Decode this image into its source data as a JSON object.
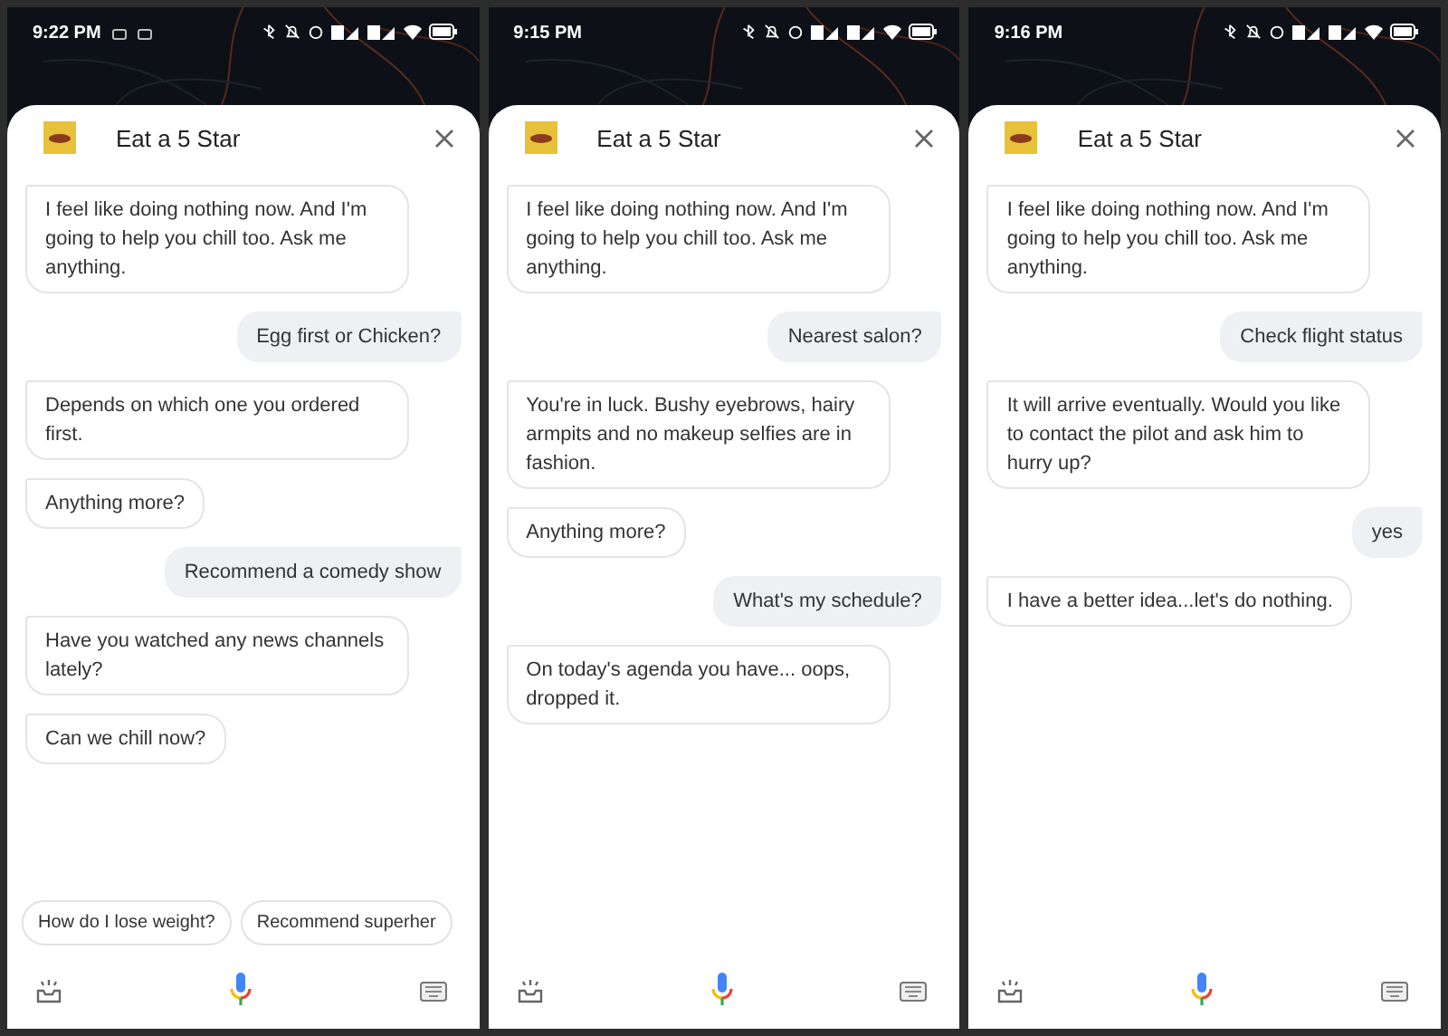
{
  "screens": [
    {
      "status_bar": {
        "time": "9:22 PM",
        "left_icons": [
          {
            "kind": "notification"
          },
          {
            "kind": "notification"
          }
        ]
      },
      "header": {
        "title": "Eat a 5 Star"
      },
      "messages": [
        {
          "kind": "bot",
          "text": "I feel like doing nothing now. And I'm going to help you chill too. Ask me anything."
        },
        {
          "kind": "user",
          "text": "Egg first or Chicken?"
        },
        {
          "kind": "bot",
          "text": "Depends on which one you ordered first."
        },
        {
          "kind": "bot",
          "text": "Anything more?"
        },
        {
          "kind": "user",
          "text": "Recommend a comedy show"
        },
        {
          "kind": "bot",
          "text": "Have you watched any news channels lately?"
        },
        {
          "kind": "bot",
          "text": "Can we chill now?"
        }
      ],
      "suggestions": [
        "How do I lose weight?",
        "Recommend superher"
      ]
    },
    {
      "status_bar": {
        "time": "9:15 PM"
      },
      "header": {
        "title": "Eat a 5 Star"
      },
      "messages": [
        {
          "kind": "bot",
          "text": "I feel like doing nothing now. And I'm going to help you chill too. Ask me anything."
        },
        {
          "kind": "user",
          "text": "Nearest salon?"
        },
        {
          "kind": "bot",
          "text": "You're in luck. Bushy eyebrows, hairy armpits and no makeup selfies are in fashion."
        },
        {
          "kind": "bot",
          "text": "Anything more?"
        },
        {
          "kind": "user",
          "text": "What's my schedule?"
        },
        {
          "kind": "bot",
          "text": "On today's agenda you have...  oops, dropped it."
        }
      ]
    },
    {
      "status_bar": {
        "time": "9:16 PM"
      },
      "header": {
        "title": "Eat a 5 Star"
      },
      "messages": [
        {
          "kind": "bot",
          "text": "I feel like doing nothing now. And I'm going to help you chill too. Ask me anything."
        },
        {
          "kind": "user",
          "text": "Check flight status"
        },
        {
          "kind": "bot",
          "text": "It will arrive eventually. Would you like to contact the pilot and ask him to hurry up?"
        },
        {
          "kind": "user",
          "text": "yes"
        },
        {
          "kind": "bot",
          "text": "I have a better idea...let's do nothing."
        }
      ]
    }
  ]
}
